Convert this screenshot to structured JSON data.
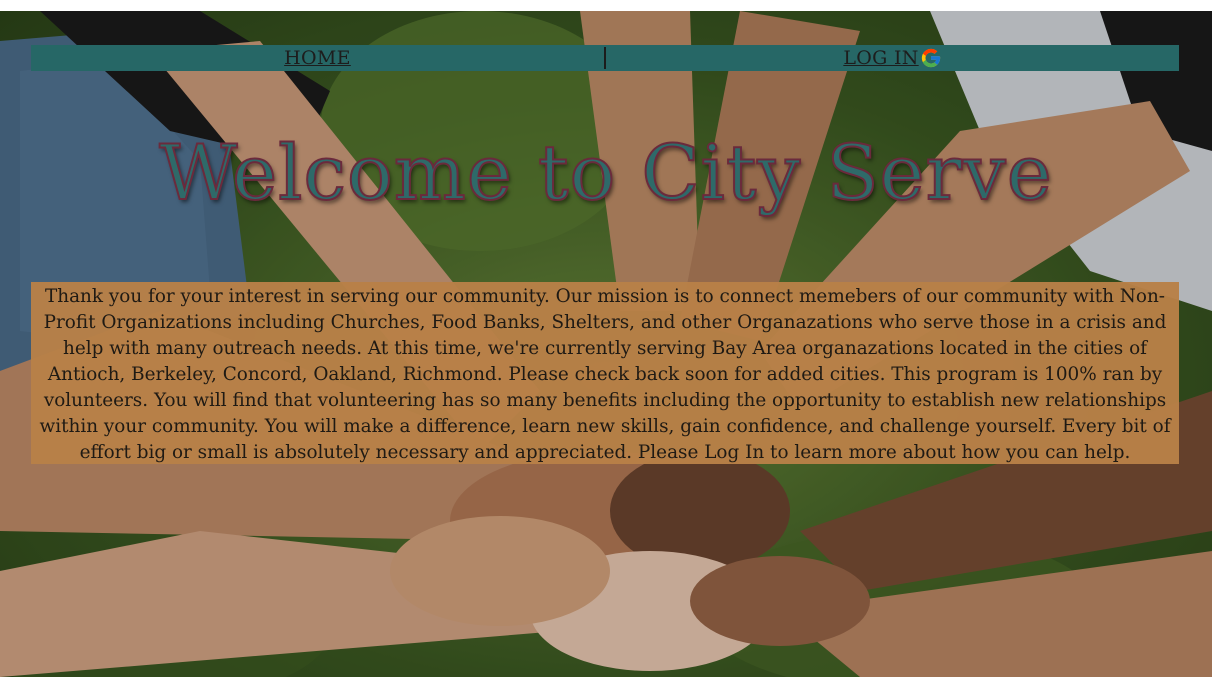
{
  "nav": {
    "home_label": "HOME",
    "login_label": "LOG IN",
    "login_icon": "google-g-icon"
  },
  "hero": {
    "title": "Welcome to City Serve",
    "background_image": "hands-together-photo"
  },
  "mission": {
    "text": "Thank you for your interest in serving our community. Our mission is to connect memebers of our community with Non-Profit Organizations including Churches, Food Banks, Shelters, and other Organazations who serve those in a crisis and help with many outreach needs. At this time, we're currently serving Bay Area organazations located in the cities of Antioch, Berkeley, Concord, Oakland, Richmond. Please check back soon for added cities. This program is 100% ran by volunteers. You will find that volunteering has so many benefits including the opportunity to establish new relationships within your community. You will make a difference, learn new skills, gain confidence, and challenge yourself. Every bit of effort big or small is absolutely necessary and appreciated. Please Log In to learn more about how you can help."
  },
  "colors": {
    "nav_bg": "#266766",
    "title_fill": "#2e6a69",
    "title_outline": "#6b2a3c",
    "mission_bg": "#b88047"
  }
}
